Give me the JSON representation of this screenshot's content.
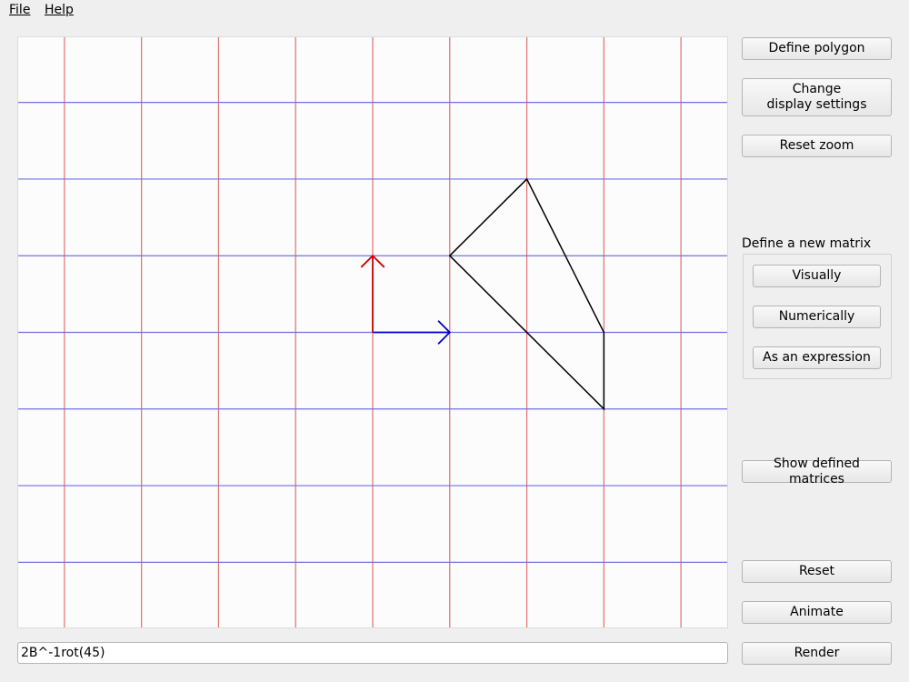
{
  "menu": {
    "file_label": "File",
    "help_label": "Help"
  },
  "buttons": {
    "define_polygon": "Define polygon",
    "change_display": "Change\ndisplay settings",
    "reset_zoom": "Reset zoom",
    "show_defined": "Show defined matrices",
    "reset": "Reset",
    "animate": "Animate",
    "render": "Render"
  },
  "matrix_group": {
    "title": "Define a new matrix",
    "visually": "Visually",
    "numerically": "Numerically",
    "as_expression": "As an expression"
  },
  "expression": {
    "value": "2B^-1rot(45)"
  },
  "plot": {
    "x_range": [
      -4.6,
      4.6
    ],
    "y_range": [
      -3.85,
      3.85
    ],
    "vertical_lines_x": [
      -4,
      -3,
      -2,
      -1,
      0,
      1,
      2,
      3,
      4
    ],
    "horizontal_lines_y": [
      3,
      2,
      1,
      0,
      -1,
      -2,
      -3
    ],
    "i_hat": [
      1,
      0
    ],
    "j_hat": [
      0,
      1
    ],
    "polygon": [
      [
        1,
        1
      ],
      [
        2,
        2
      ],
      [
        3,
        0
      ],
      [
        3,
        -1
      ]
    ],
    "colors": {
      "vertical_grid": "#e07070",
      "horizontal_grid": "#7070e0",
      "i_hat": "#0000cc",
      "j_hat": "#cc0000",
      "polygon": "#000000"
    }
  }
}
